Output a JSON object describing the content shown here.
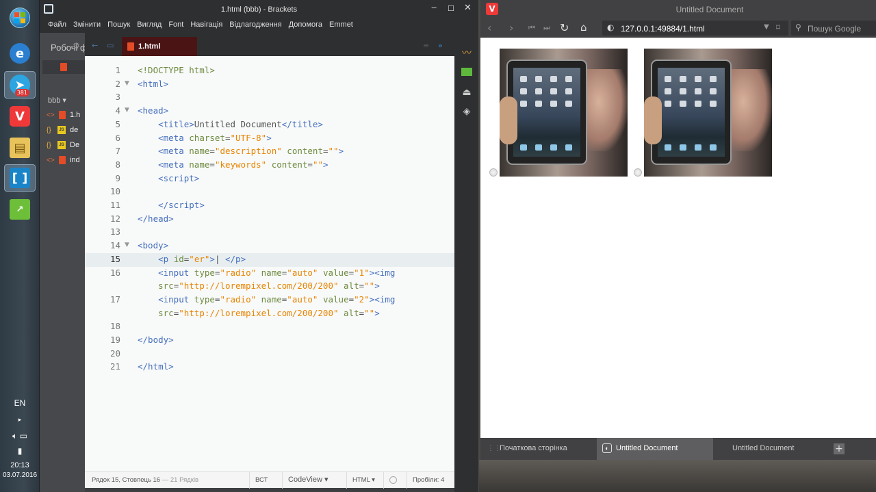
{
  "taskbar": {
    "telegram_badge": "381",
    "language": "EN",
    "time": "20:13",
    "date": "03.07.2016"
  },
  "brackets": {
    "title": "1.html (bbb) - Brackets",
    "menu": [
      "Файл",
      "Змінити",
      "Пошук",
      "Вигляд",
      "Font",
      "Навігація",
      "Відлагодження",
      "Допомога",
      "Emmet"
    ],
    "sidebar": {
      "working_files_label": "Робочі ф",
      "project_label": "bbb",
      "files": [
        {
          "name": "1.h",
          "type": "html"
        },
        {
          "name": "de",
          "type": "js"
        },
        {
          "name": "De",
          "type": "js"
        },
        {
          "name": "ind",
          "type": "html"
        }
      ]
    },
    "tab": {
      "label": "1.html"
    },
    "code_lines": [
      {
        "n": "1",
        "html": "<span class=\"d\">&lt;!DOCTYPE html&gt;</span>"
      },
      {
        "n": "2",
        "html": "<span class=\"t\">&lt;html&gt;</span>"
      },
      {
        "n": "3",
        "html": ""
      },
      {
        "n": "4",
        "html": "<span class=\"t\">&lt;head&gt;</span>"
      },
      {
        "n": "5",
        "html": "    <span class=\"t\">&lt;title&gt;</span>Untitled Document<span class=\"t\">&lt;/title&gt;</span>"
      },
      {
        "n": "6",
        "html": "    <span class=\"t\">&lt;meta</span> <span class=\"a\">charset</span>=<span class=\"s\">\"UTF-8\"</span><span class=\"t\">&gt;</span>"
      },
      {
        "n": "7",
        "html": "    <span class=\"t\">&lt;meta</span> <span class=\"a\">name</span>=<span class=\"s\">\"description\"</span> <span class=\"a\">content</span>=<span class=\"s\">\"\"</span><span class=\"t\">&gt;</span>"
      },
      {
        "n": "8",
        "html": "    <span class=\"t\">&lt;meta</span> <span class=\"a\">name</span>=<span class=\"s\">\"keywords\"</span> <span class=\"a\">content</span>=<span class=\"s\">\"\"</span><span class=\"t\">&gt;</span>"
      },
      {
        "n": "9",
        "html": "    <span class=\"t\">&lt;script&gt;</span>"
      },
      {
        "n": "10",
        "html": ""
      },
      {
        "n": "11",
        "html": "    <span class=\"t\">&lt;/script&gt;</span>"
      },
      {
        "n": "12",
        "html": "<span class=\"t\">&lt;/head&gt;</span>"
      },
      {
        "n": "13",
        "html": ""
      },
      {
        "n": "14",
        "html": "<span class=\"t\">&lt;body&gt;</span>"
      },
      {
        "n": "15",
        "html": "    <span class=\"t\">&lt;p</span> <span class=\"a\">id</span>=<span class=\"s\">\"er\"</span><span class=\"t\">&gt;</span>| <span class=\"t\">&lt;/p&gt;</span>"
      },
      {
        "n": "16",
        "html": "    <span class=\"t\">&lt;input</span> <span class=\"a\">type</span>=<span class=\"s\">\"radio\"</span> <span class=\"a\">name</span>=<span class=\"s\">\"auto\"</span> <span class=\"a\">value</span>=<span class=\"s\">\"1\"</span><span class=\"t\">&gt;&lt;img</span>"
      },
      {
        "n": "",
        "html": "    <span class=\"a\">src</span>=<span class=\"s\">\"http://lorempixel.com/200/200\"</span> <span class=\"a\">alt</span>=<span class=\"s\">\"\"</span><span class=\"t\">&gt;</span>"
      },
      {
        "n": "17",
        "html": "    <span class=\"t\">&lt;input</span> <span class=\"a\">type</span>=<span class=\"s\">\"radio\"</span> <span class=\"a\">name</span>=<span class=\"s\">\"auto\"</span> <span class=\"a\">value</span>=<span class=\"s\">\"2\"</span><span class=\"t\">&gt;&lt;img</span>"
      },
      {
        "n": "",
        "html": "    <span class=\"a\">src</span>=<span class=\"s\">\"http://lorempixel.com/200/200\"</span> <span class=\"a\">alt</span>=<span class=\"s\">\"\"</span><span class=\"t\">&gt;</span>"
      },
      {
        "n": "18",
        "html": ""
      },
      {
        "n": "19",
        "html": "<span class=\"t\">&lt;/body&gt;</span>"
      },
      {
        "n": "20",
        "html": ""
      },
      {
        "n": "21",
        "html": "<span class=\"t\">&lt;/html&gt;</span>"
      }
    ],
    "status": {
      "position": "Рядок 15, Стовпець 16",
      "line_count": "— 21 Рядків",
      "mode": "ВСТ",
      "view": "CodeView ▾",
      "language": "HTML ▾",
      "spaces": "Пробіли: 4"
    }
  },
  "vivaldi": {
    "title": "Untitled Document",
    "url": "127.0.0.1:49884/1.html",
    "search_placeholder": "Пошук Google",
    "tabs": [
      {
        "label": "Початкова сторінка",
        "active": false
      },
      {
        "label": "Untitled Document",
        "active": true
      },
      {
        "label": "Untitled Document",
        "active": false
      }
    ]
  }
}
